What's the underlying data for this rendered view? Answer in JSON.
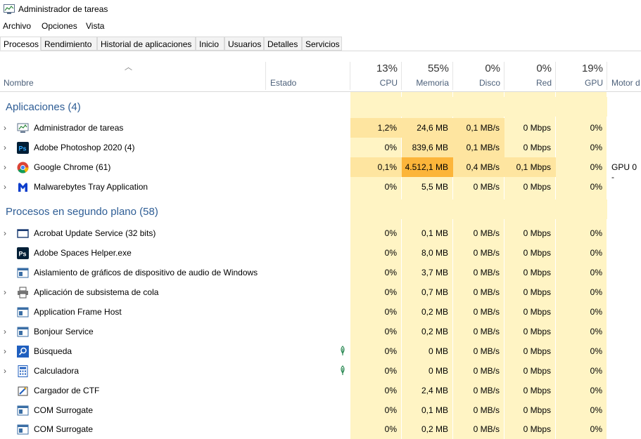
{
  "window": {
    "title": "Administrador de tareas"
  },
  "menu": [
    "Archivo",
    "Opciones",
    "Vista"
  ],
  "tabs": [
    "Procesos",
    "Rendimiento",
    "Historial de aplicaciones",
    "Inicio",
    "Usuarios",
    "Detalles",
    "Servicios"
  ],
  "columns": {
    "nombre": "Nombre",
    "estado": "Estado",
    "cpu": {
      "pct": "13%",
      "label": "CPU"
    },
    "memoria": {
      "pct": "55%",
      "label": "Memoria"
    },
    "disco": {
      "pct": "0%",
      "label": "Disco"
    },
    "red": {
      "pct": "0%",
      "label": "Red"
    },
    "gpu": {
      "pct": "19%",
      "label": "GPU"
    },
    "motor": "Motor d"
  },
  "groups": {
    "apps": "Aplicaciones (4)",
    "background": "Procesos en segundo plano (58)"
  },
  "apps": [
    {
      "name": "Administrador de tareas",
      "cpu": "1,2%",
      "mem": "24,6 MB",
      "disk": "0,1 MB/s",
      "net": "0 Mbps",
      "gpu": "0%",
      "extra": ""
    },
    {
      "name": "Adobe Photoshop 2020 (4)",
      "cpu": "0%",
      "mem": "839,6 MB",
      "disk": "0,1 MB/s",
      "net": "0 Mbps",
      "gpu": "0%",
      "extra": ""
    },
    {
      "name": "Google Chrome (61)",
      "cpu": "0,1%",
      "mem": "4.512,1 MB",
      "disk": "0,4 MB/s",
      "net": "0,1 Mbps",
      "gpu": "0%",
      "extra": "GPU 0 -"
    },
    {
      "name": "Malwarebytes Tray Application",
      "cpu": "0%",
      "mem": "5,5 MB",
      "disk": "0 MB/s",
      "net": "0 Mbps",
      "gpu": "0%",
      "extra": ""
    }
  ],
  "background": [
    {
      "name": "Acrobat Update Service (32 bits)",
      "cpu": "0%",
      "mem": "0,1 MB",
      "disk": "0 MB/s",
      "net": "0 Mbps",
      "gpu": "0%"
    },
    {
      "name": "Adobe Spaces Helper.exe",
      "cpu": "0%",
      "mem": "8,0 MB",
      "disk": "0 MB/s",
      "net": "0 Mbps",
      "gpu": "0%"
    },
    {
      "name": "Aislamiento de gráficos de dispositivo de audio de Windows",
      "cpu": "0%",
      "mem": "3,7 MB",
      "disk": "0 MB/s",
      "net": "0 Mbps",
      "gpu": "0%"
    },
    {
      "name": "Aplicación de subsistema de cola",
      "cpu": "0%",
      "mem": "0,7 MB",
      "disk": "0 MB/s",
      "net": "0 Mbps",
      "gpu": "0%"
    },
    {
      "name": "Application Frame Host",
      "cpu": "0%",
      "mem": "0,2 MB",
      "disk": "0 MB/s",
      "net": "0 Mbps",
      "gpu": "0%"
    },
    {
      "name": "Bonjour Service",
      "cpu": "0%",
      "mem": "0,2 MB",
      "disk": "0 MB/s",
      "net": "0 Mbps",
      "gpu": "0%"
    },
    {
      "name": "Búsqueda",
      "cpu": "0%",
      "mem": "0 MB",
      "disk": "0 MB/s",
      "net": "0 Mbps",
      "gpu": "0%"
    },
    {
      "name": "Calculadora",
      "cpu": "0%",
      "mem": "0 MB",
      "disk": "0 MB/s",
      "net": "0 Mbps",
      "gpu": "0%"
    },
    {
      "name": "Cargador de CTF",
      "cpu": "0%",
      "mem": "2,4 MB",
      "disk": "0 MB/s",
      "net": "0 Mbps",
      "gpu": "0%"
    },
    {
      "name": "COM Surrogate",
      "cpu": "0%",
      "mem": "0,1 MB",
      "disk": "0 MB/s",
      "net": "0 Mbps",
      "gpu": "0%"
    },
    {
      "name": "COM Surrogate",
      "cpu": "0%",
      "mem": "0,2 MB",
      "disk": "0 MB/s",
      "net": "0 Mbps",
      "gpu": "0%"
    }
  ],
  "colors": {
    "heat_light": "#fff4c4",
    "heat_mid": "#fee5a0",
    "heat_high": "#fcb53a",
    "group": "#2e5d95"
  }
}
